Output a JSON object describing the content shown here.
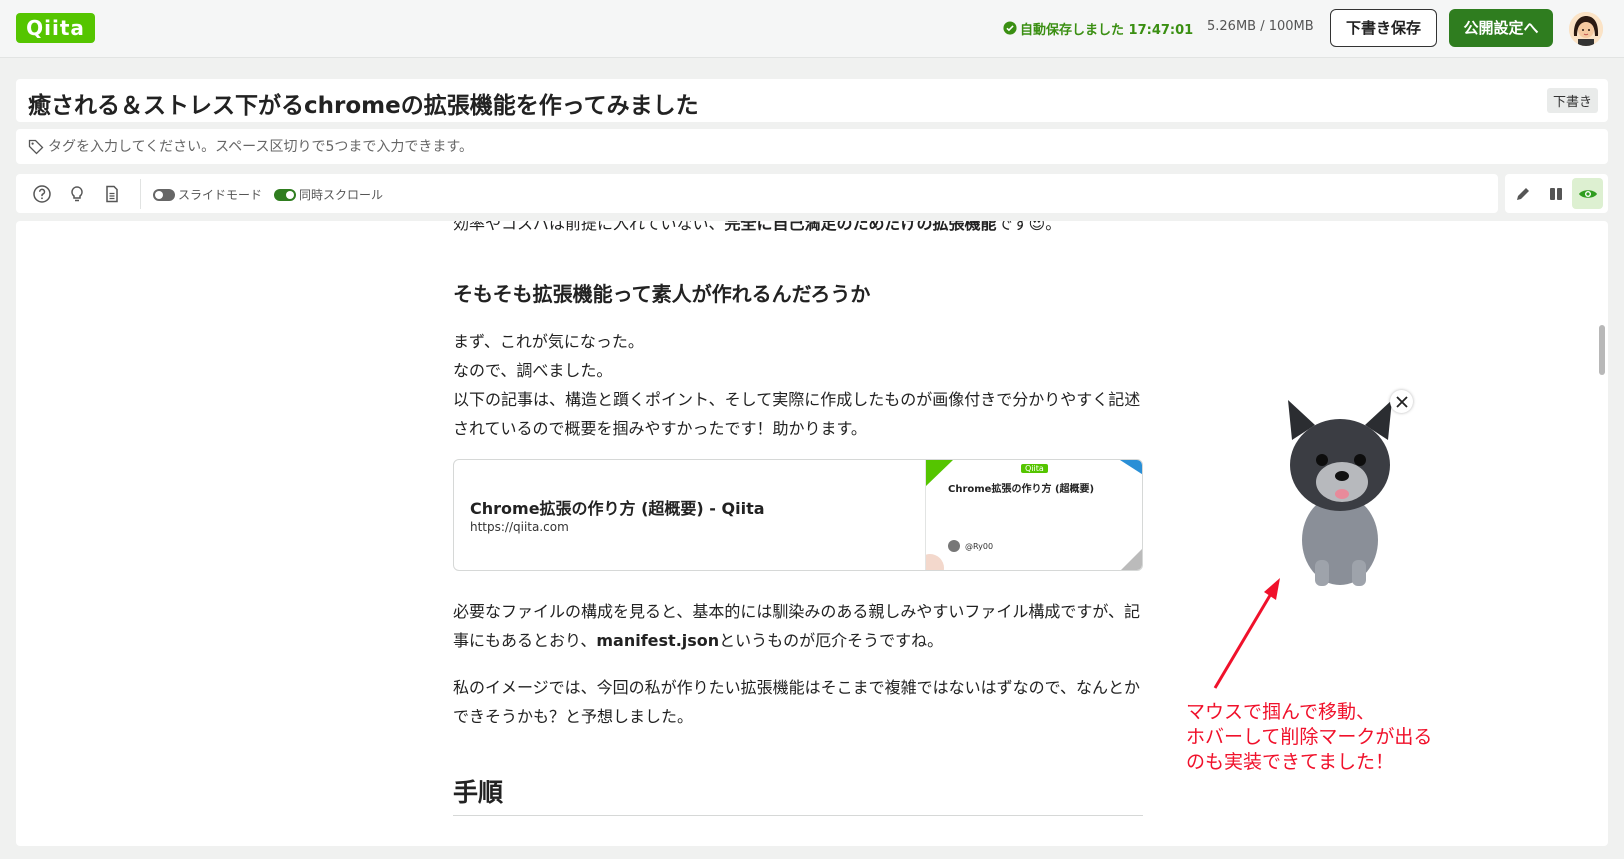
{
  "header": {
    "logo": "Qiita",
    "autosave": "自動保存しました 17:47:01",
    "storage": "5.26MB / 100MB",
    "draft_button": "下書き保存",
    "publish_button": "公開設定へ"
  },
  "editor": {
    "title": "癒される＆ストレス下がるchromeの拡張機能を作ってみました",
    "status_badge": "下書き",
    "tags_placeholder": "タグを入力してください。スペース区切りで5つまで入力できます。"
  },
  "toolbar": {
    "slide_mode": "スライドモード",
    "sync_scroll": "同時スクロール",
    "slide_mode_on": false,
    "sync_scroll_on": true
  },
  "preview": {
    "cut_line_normal": "効率やコスパは前提に入れていない、",
    "cut_line_bold": "完全に自己満足のためだけの拡張機能",
    "cut_line_end": "です😍。",
    "heading_1": "そもそも拡張機能って素人が作れるんだろうか",
    "para1_l1": "まず、これが気になった。",
    "para1_l2": "なので、調べました。",
    "para1_l3": "以下の記事は、構造と躓くポイント、そして実際に作成したものが画像付きで分かりやすく記述されているので概要を掴みやすかったです！助かります。",
    "link_card": {
      "title": "Chrome拡張の作り方 (超概要) - Qiita",
      "url": "https://qiita.com",
      "thumb_badge": "Qiita",
      "thumb_title": "Chrome拡張の作り方 (超概要)",
      "thumb_author": "@Ry00"
    },
    "para2_a": "必要なファイルの構成を見ると、基本的には馴染みのある親しみやすいファイル構成ですが、記事にもあるとおり、",
    "para2_bold": "manifest.json",
    "para2_b": "というものが厄介そうですね。",
    "para3": "私のイメージでは、今回の私が作りたい拡張機能はそこまで複雑ではないはずなので、なんとかできそうかも？と予想しました。",
    "heading_2": "手順"
  },
  "annotation": {
    "line1": "マウスで掴んで移動、",
    "line2": "ホバーして削除マークが出る",
    "line3": "のも実装できてました！"
  },
  "colors": {
    "brand": "#55c500",
    "publish": "#2f7d1f",
    "annotation": "#f0112b"
  }
}
